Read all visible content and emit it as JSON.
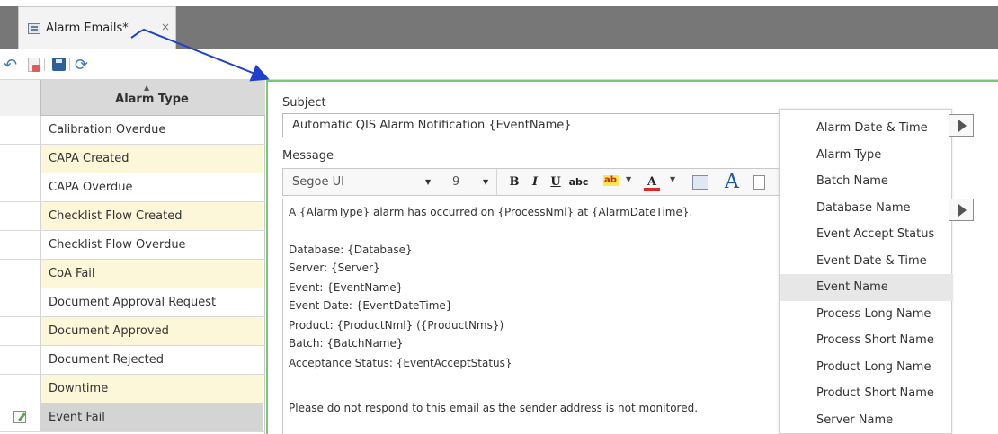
{
  "tab": {
    "title": "Alarm Emails*",
    "close": "×"
  },
  "toolbar": {
    "undo_icon": "undo-icon",
    "page_icon": "page-delete-icon",
    "save_icon": "save-icon",
    "refresh_icon": "refresh-icon"
  },
  "grid": {
    "sort_indicator": "▲",
    "column_title": "Alarm Type",
    "rows": [
      "Calibration Overdue",
      "CAPA Created",
      "CAPA Overdue",
      "Checklist Flow Created",
      "Checklist Flow Overdue",
      "CoA Fail",
      "Document Approval Request",
      "Document Approved",
      "Document Rejected",
      "Downtime",
      "Event Fail"
    ],
    "selected_row": "Event Fail"
  },
  "editor": {
    "subject_label": "Subject",
    "subject_value": "Automatic QIS Alarm Notification {EventName}",
    "message_label": "Message",
    "format_toolbar": {
      "font_name": "Segoe UI",
      "font_size": "9",
      "dropdown_arrow": "▼",
      "bold": "B",
      "italic": "I",
      "underline": "U",
      "strikethrough": "abc",
      "font_color": "A",
      "large_font": "A"
    },
    "message_lines": [
      "A {AlarmType} alarm has occurred on {ProcessNml} at {AlarmDateTime}.",
      "",
      "Database: {Database}",
      "Server: {Server}",
      "Event: {EventName}",
      "Event Date: {EventDateTime}",
      "Product: {ProductNml} ({ProductNms})",
      "Batch: {BatchName}",
      "Acceptance Status: {EventAcceptStatus}",
      "",
      "Please do not respond to this email as the sender address is not monitored."
    ]
  },
  "fields_list": {
    "items": [
      "Alarm Date & Time",
      "Alarm Type",
      "Batch Name",
      "Database Name",
      "Event Accept Status",
      "Event Date & Time",
      "Event Name",
      "Process Long Name",
      "Process Short Name",
      "Product Long Name",
      "Product Short Name",
      "Server Name"
    ],
    "selected_item": "Event Name"
  },
  "colors": {
    "row_alt": "#fbf7d8",
    "selected": "#d4d4d4",
    "editor_accent": "#76ca76",
    "annotation_arrow": "#1f3fce"
  }
}
